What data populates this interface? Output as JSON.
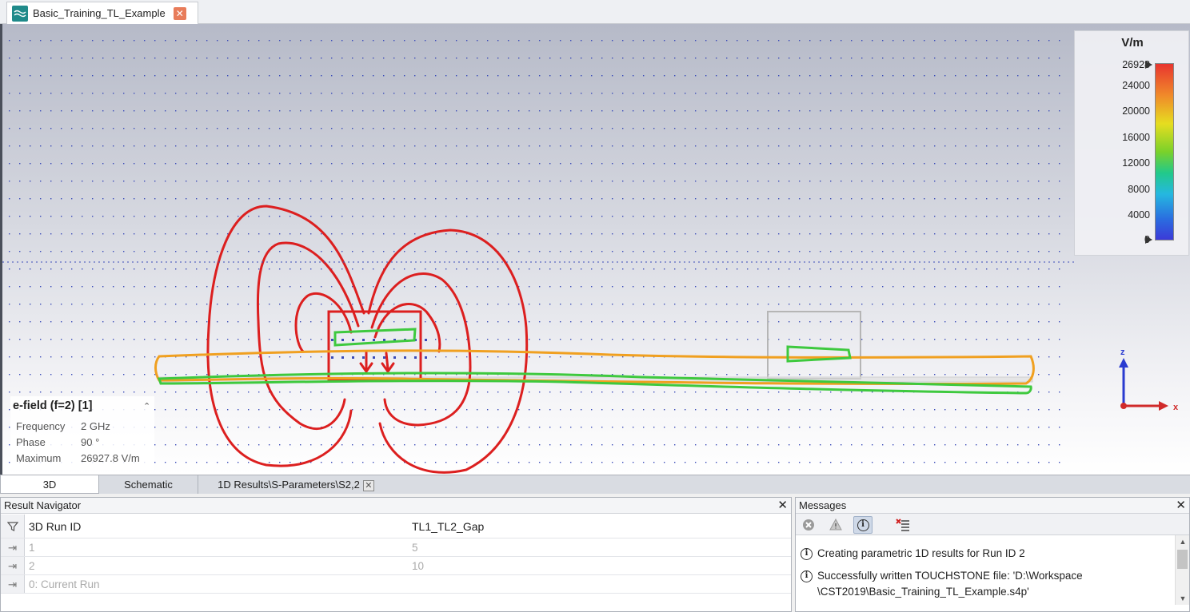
{
  "document_tab": {
    "title": "Basic_Training_TL_Example"
  },
  "legend": {
    "unit": "V/m",
    "ticks": [
      "26928",
      "24000",
      "20000",
      "16000",
      "12000",
      "8000",
      "4000",
      "0"
    ]
  },
  "info": {
    "title": "e-field (f=2) [1]",
    "rows": [
      {
        "label": "Frequency",
        "value": "2 GHz"
      },
      {
        "label": "Phase",
        "value": "90 °"
      },
      {
        "label": "Maximum",
        "value": "26927.8 V/m"
      }
    ]
  },
  "axes": {
    "z": "z",
    "x": "x"
  },
  "view_tabs": [
    {
      "label": "3D",
      "active": true
    },
    {
      "label": "Schematic",
      "active": false
    },
    {
      "label": "1D Results\\S-Parameters\\S2,2",
      "active": false,
      "closable": true
    }
  ],
  "result_navigator": {
    "title": "Result Navigator",
    "columns": [
      "3D Run ID",
      "TL1_TL2_Gap"
    ],
    "rows": [
      {
        "id": "1",
        "value": "5"
      },
      {
        "id": "2",
        "value": "10"
      },
      {
        "id": "0: Current Run",
        "value": ""
      }
    ]
  },
  "messages": {
    "title": "Messages",
    "lines": [
      "Creating parametric 1D results for Run ID 2",
      "Successfully written TOUCHSTONE file: 'D:\\Workspace",
      "\\CST2019\\Basic_Training_TL_Example.s4p'"
    ]
  },
  "colors": {
    "annotation_red": "#dc1f1f",
    "annotation_green": "#3ec93e",
    "annotation_orange": "#f0a020"
  }
}
